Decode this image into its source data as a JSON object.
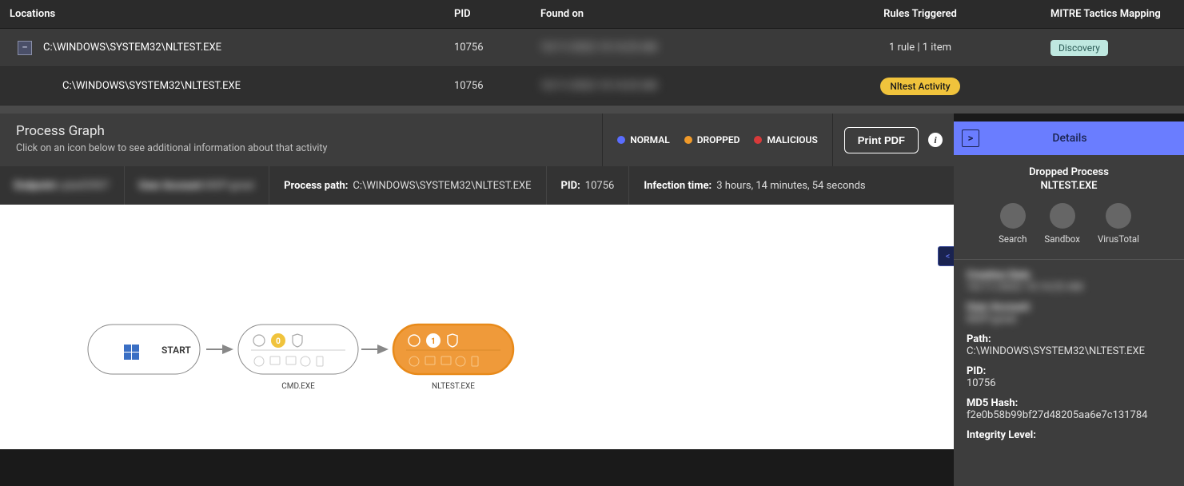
{
  "table": {
    "headers": {
      "locations": "Locations",
      "pid": "PID",
      "found": "Found on",
      "rules": "Rules Triggered",
      "mitre": "MITRE Tactics Mapping"
    },
    "rows": [
      {
        "expand": "–",
        "location": "C:\\WINDOWS\\SYSTEM32\\NLTEST.EXE",
        "pid": "10756",
        "found": "10/11/2022 10:14:25 AM",
        "rules": "1 rule | 1 item",
        "mitre": "Discovery"
      },
      {
        "location": "C:\\WINDOWS\\SYSTEM32\\NLTEST.EXE",
        "pid": "10756",
        "found": "10/11/2022 10:14:25 AM",
        "rules_badge": "Nltest Activity"
      }
    ]
  },
  "process_graph": {
    "title": "Process Graph",
    "subtitle": "Click on an icon below to see additional information about that activity",
    "legend": {
      "normal": "NORMAL",
      "dropped": "DROPPED",
      "malicious": "MALICIOUS"
    },
    "print": "Print PDF"
  },
  "info_bar": {
    "endpoint_label": "Endpoint",
    "endpoint_val": "cybe03907",
    "user_label": "User Account",
    "user_val": "MSP\\great",
    "path_label": "Process path:",
    "path_val": "C:\\WINDOWS\\SYSTEM32\\NLTEST.EXE",
    "pid_label": "PID:",
    "pid_val": "10756",
    "infection_label": "Infection time:",
    "infection_val": "3 hours, 14 minutes, 54 seconds"
  },
  "graph_nodes": {
    "start": "START",
    "cmd": "CMD.EXE",
    "nltest": "NLTEST.EXE"
  },
  "details": {
    "header": "Details",
    "type": "Dropped Process",
    "name": "NLTEST.EXE",
    "actions": {
      "search": "Search",
      "sandbox": "Sandbox",
      "virustotal": "VirusTotal"
    },
    "creation_label": "Creation Date",
    "creation_val": "10/11/2022 10:14:25 AM",
    "user_label": "User Account",
    "user_val": "MSP\\great",
    "path_label": "Path:",
    "path_val": "C:\\WINDOWS\\SYSTEM32\\NLTEST.EXE",
    "pid_label": "PID:",
    "pid_val": "10756",
    "md5_label": "MD5 Hash:",
    "md5_val": "f2e0b58b99bf27d48205aa6e7c131784",
    "integrity_label": "Integrity Level:"
  }
}
